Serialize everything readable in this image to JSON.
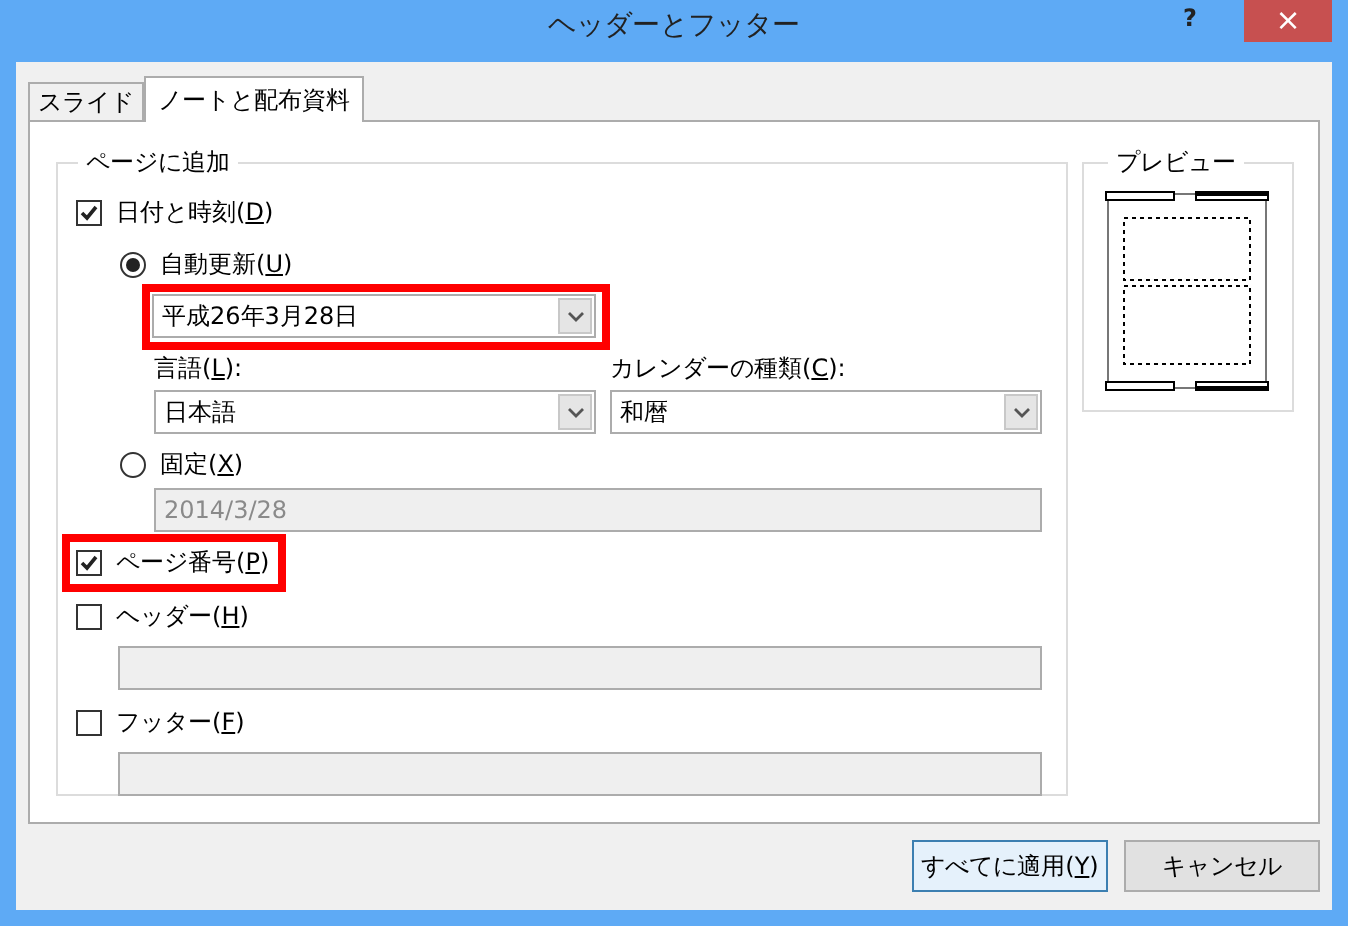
{
  "window": {
    "title": "ヘッダーとフッター",
    "help": "?",
    "close": "×"
  },
  "tabs": [
    {
      "label": "スライド",
      "selected": false
    },
    {
      "label": "ノートと配布資料",
      "selected": true
    }
  ],
  "add_to_page": {
    "title": "ページに追加",
    "date_time": {
      "label": "日付と時刻(D)",
      "checked": true
    },
    "auto_update": {
      "label": "自動更新(U)",
      "selected": true,
      "value": "平成26年3月28日",
      "highlighted": true
    },
    "language": {
      "label": "言語(L):",
      "value": "日本語"
    },
    "calendar": {
      "label": "カレンダーの種類(C):",
      "value": "和暦"
    },
    "fixed": {
      "label": "固定(X)",
      "selected": false,
      "value": "2014/3/28",
      "disabled": true
    },
    "page_number": {
      "label": "ページ番号(P)",
      "checked": true,
      "highlighted": true
    },
    "header": {
      "label": "ヘッダー(H)",
      "checked": false,
      "disabled": true
    },
    "footer": {
      "label": "フッター(F)",
      "checked": false,
      "disabled": true
    }
  },
  "preview": {
    "title": "プレビュー"
  },
  "buttons": [
    {
      "label": "すべてに適用(Y)",
      "default": true
    },
    {
      "label": "キャンセル",
      "default": false
    }
  ]
}
